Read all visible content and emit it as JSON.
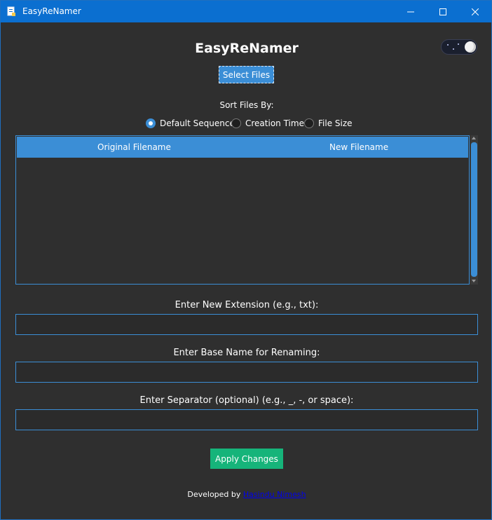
{
  "window": {
    "title": "EasyReNamer",
    "controls": {
      "minimize": "minimize-icon",
      "maximize": "maximize-icon",
      "close": "close-icon"
    }
  },
  "header": {
    "title": "EasyReNamer",
    "theme_toggle_icon": "moon-icon"
  },
  "toolbar": {
    "select_files_label": "Select Files"
  },
  "sort": {
    "label": "Sort Files By:",
    "options": [
      {
        "label": "Default Sequence",
        "checked": true
      },
      {
        "label": "Creation Time",
        "checked": false
      },
      {
        "label": "File Size",
        "checked": false
      }
    ]
  },
  "table": {
    "columns": [
      "Original Filename",
      "New Filename"
    ],
    "rows": []
  },
  "fields": {
    "extension": {
      "label": "Enter New Extension (e.g., txt):",
      "value": ""
    },
    "base_name": {
      "label": "Enter Base Name for Renaming:",
      "value": ""
    },
    "separator": {
      "label": "Enter Separator (optional) (e.g., _, -, or space):",
      "value": ""
    }
  },
  "actions": {
    "apply_label": "Apply Changes"
  },
  "footer": {
    "prefix": "Developed by",
    "author": "Hasindu Nimesh"
  },
  "colors": {
    "accent": "#3b8ed6",
    "apply": "#16b47a",
    "titlebar": "#0b6fd0",
    "background": "#2f2f2f"
  }
}
